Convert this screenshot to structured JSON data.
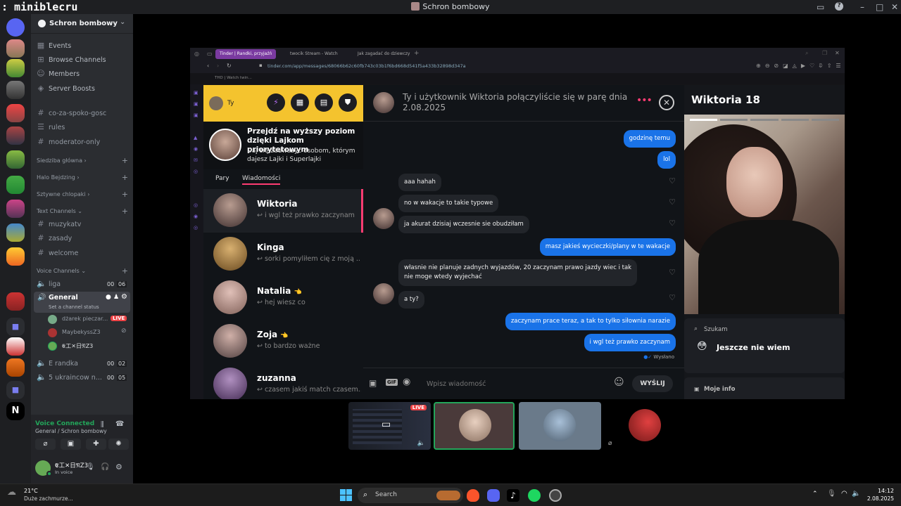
{
  "window": {
    "app_name": ": miniblecru",
    "title": "Schron bombowy"
  },
  "sidebar": {
    "guild_name": "Schron bombowy",
    "top_items": [
      {
        "icon": "calendar-icon",
        "label": "Events"
      },
      {
        "icon": "grid-icon",
        "label": "Browse Channels"
      },
      {
        "icon": "people-icon",
        "label": "Members"
      },
      {
        "icon": "boost-icon",
        "label": "Server Boosts"
      }
    ],
    "text_top": [
      "co-za-spoko-gosc",
      "rules",
      "moderator-only"
    ],
    "categories": {
      "siedziba": "Siedziba główna",
      "halo": "Halo Bejdzing",
      "sztywne": "Sztywne chlopaki",
      "text": "Text Channels",
      "voice": "Voice Channels"
    },
    "text_channels": [
      "muzykatv",
      "zasady",
      "welcome"
    ],
    "voice": {
      "liga": {
        "name": "liga",
        "c1": "00",
        "c2": "06"
      },
      "general": {
        "name": "General",
        "status": "Set a channel status"
      },
      "users": [
        {
          "name": "dżarek pieczar...",
          "badge": "LIVE"
        },
        {
          "name": "MaybekyssZ3"
        },
        {
          "name": "𝕰工✕日𝔑Z3"
        }
      ],
      "erandka": {
        "name": "E randka",
        "c1": "00",
        "c2": "02"
      },
      "ukraincow": {
        "name": "5 ukraincow n...",
        "c1": "00",
        "c2": "05"
      }
    },
    "panel": {
      "voice_connected": "Voice Connected",
      "voice_sub": "General / Schron bombowy",
      "username": "𝕰工✕日𝔑Z3",
      "status": "In voice"
    }
  },
  "browser": {
    "tabs": [
      "Tinder | Randki, przyjaźń",
      "twocik Stream - Watch",
      "Jak zagadać do dziewczy"
    ],
    "url": "tinder.com/app/messages/68066b62c60fb743c03b1f6bd668d541f5a433b32898d347a",
    "bookmark": "THD | Watch twin..."
  },
  "tinder": {
    "header": {
      "name": "Ty"
    },
    "promo": {
      "title": "Przejdź na wyższy poziom dzięki Lajkom priorytetowym",
      "subtitle": "Daj się zauważyć osobom, którym dajesz Lajki i Superlajki"
    },
    "tabs": {
      "pairs": "Pary",
      "messages": "Wiadomości"
    },
    "matches": [
      {
        "name": "Wiktoria",
        "preview": "i wgl też prawko zaczynam",
        "emoji": ""
      },
      {
        "name": "Kinga",
        "preview": "sorki pomyliłem cię z moją ...",
        "emoji": ""
      },
      {
        "name": "Natalia",
        "preview": "hej wiesz co",
        "emoji": "👈"
      },
      {
        "name": "Zoja",
        "preview": "to bardzo ważne",
        "emoji": "👈"
      },
      {
        "name": "zuzanna",
        "preview": "czasem jakiś match czasem...",
        "emoji": ""
      }
    ],
    "chat": {
      "title": "Ty i użytkownik Wiktoria połączyliście się w parę dnia 2.08.2025",
      "messages": [
        {
          "side": "right",
          "text": "godzinę temu"
        },
        {
          "side": "right",
          "text": "lol"
        },
        {
          "side": "left",
          "text": "aaa hahah"
        },
        {
          "side": "left",
          "text": "no w wakacje to takie typowe"
        },
        {
          "side": "left",
          "text": "ja akurat dzisiaj wczesnie sie obudziłam"
        },
        {
          "side": "right",
          "text": "masz jakieś wycieczki/plany w te wakacje"
        },
        {
          "side": "left",
          "text": "własnie nie planuje zadnych wyjazdów, 20 zaczynam prawo jazdy wiec i tak\nnie moge wtedy wyjechać"
        },
        {
          "side": "left",
          "text": "a ty?"
        },
        {
          "side": "right",
          "text": "zaczynam prace teraz, a tak to tylko siłownia narazie"
        },
        {
          "side": "right",
          "text": "i wgl też prawko zaczynam"
        }
      ],
      "sent": "Wysłano",
      "input_placeholder": "Wpisz wiadomość",
      "send": "WYŚLIJ"
    },
    "profile": {
      "name_age": "Wiktoria 18",
      "seeking_label": "Szukam",
      "seeking_value": "Jeszcze nie wiem",
      "my_info": "Moje info"
    }
  },
  "stream_tiles": {
    "live": "LIVE"
  },
  "taskbar": {
    "weather_temp": "21°C",
    "weather_desc": "Duże zachmurze...",
    "search": "Search",
    "time": "14:12",
    "date": "2.08.2025"
  },
  "colors": {
    "tinder_yellow": "#f4c32e",
    "bubble_blue": "#1a73e8",
    "discord_green": "#23a55a",
    "live_red": "#ed4245"
  }
}
